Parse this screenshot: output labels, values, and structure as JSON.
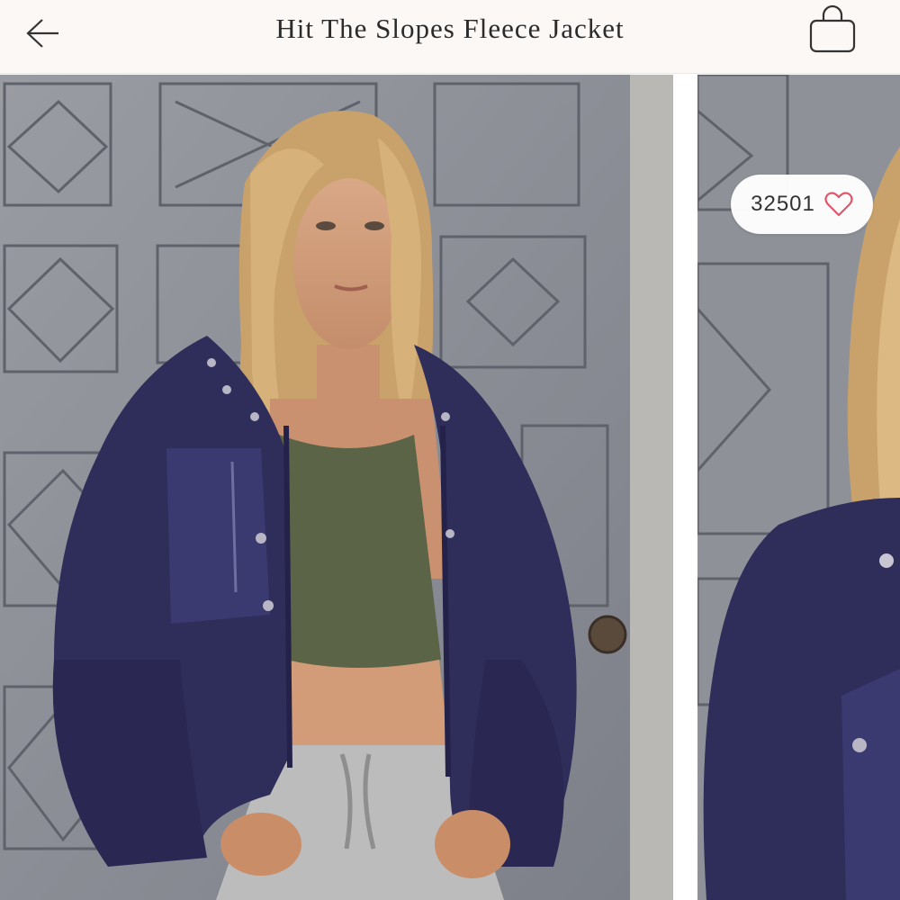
{
  "header": {
    "title": "Hit The Slopes Fleece Jacket",
    "back_icon": "arrow-left-icon",
    "bag_icon": "shopping-bag-icon"
  },
  "gallery": {
    "images": [
      {
        "alt": "Model wearing navy fleece jacket with olive crop top in front of carved wooden door"
      },
      {
        "alt": "Close-up of navy fleece jacket collar and snaps"
      }
    ]
  },
  "favorite": {
    "count": "32501",
    "icon": "heart-outline-icon"
  },
  "colors": {
    "header_bg": "#fbf8f5",
    "heart": "#e0566a",
    "jacket_navy": "#2f2d5a",
    "door_gray": "#8d8f97"
  }
}
